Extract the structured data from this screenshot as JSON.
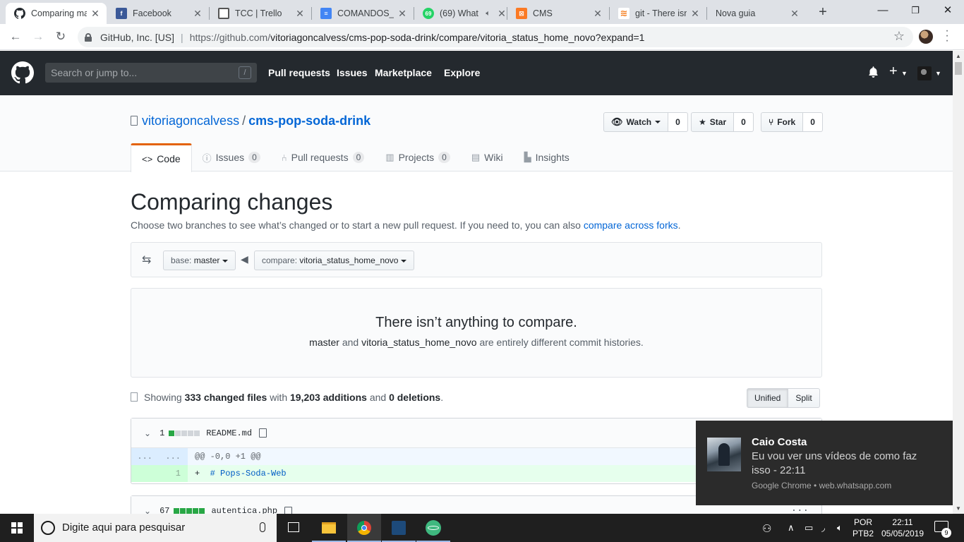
{
  "browser": {
    "tabs": [
      {
        "title": "Comparing ma",
        "favicon": "github-icon",
        "active": true
      },
      {
        "title": "Facebook",
        "favicon": "facebook-icon"
      },
      {
        "title": "TCC | Trello",
        "favicon": "trello-icon"
      },
      {
        "title": "COMANDOS_C",
        "favicon": "google-docs-icon"
      },
      {
        "title": "(69) What",
        "favicon": "whatsapp-icon",
        "badge": "69"
      },
      {
        "title": "CMS",
        "favicon": "xampp-icon"
      },
      {
        "title": "git - There isn",
        "favicon": "stackoverflow-icon"
      },
      {
        "title": "Nova guia",
        "favicon": ""
      }
    ],
    "address": {
      "org": "GitHub, Inc. [US]",
      "url_host": "https://github.com/",
      "url_path": "vitoriagoncalvess/cms-pop-soda-drink/compare/vitoria_status_home_novo?expand=1"
    }
  },
  "gh_header": {
    "search_placeholder": "Search or jump to...",
    "search_key": "/",
    "nav": [
      "Pull requests",
      "Issues",
      "Marketplace",
      "Explore"
    ]
  },
  "repo": {
    "owner": "vitoriagoncalvess",
    "separator": "/",
    "name": "cms-pop-soda-drink",
    "watch": {
      "label": "Watch",
      "count": "0"
    },
    "star": {
      "label": "Star",
      "count": "0"
    },
    "fork": {
      "label": "Fork",
      "count": "0"
    },
    "tabs": [
      {
        "label": "Code",
        "icon": "code-icon",
        "selected": true
      },
      {
        "label": "Issues",
        "icon": "issue-icon",
        "count": "0"
      },
      {
        "label": "Pull requests",
        "icon": "pull-request-icon",
        "count": "0"
      },
      {
        "label": "Projects",
        "icon": "project-icon",
        "count": "0"
      },
      {
        "label": "Wiki",
        "icon": "wiki-icon"
      },
      {
        "label": "Insights",
        "icon": "graph-icon"
      }
    ]
  },
  "compare": {
    "title": "Comparing changes",
    "subtitle": "Choose two branches to see what’s changed or to start a new pull request. If you need to, you can also",
    "subtitle_link": "compare across forks",
    "subtitle_end": ".",
    "base_prefix": "base:",
    "base_branch": "master",
    "compare_prefix": "compare:",
    "compare_branch": "vitoria_status_home_novo",
    "blank_title": "There isn’t anything to compare.",
    "blank_base": "master",
    "blank_and": "and",
    "blank_head": "vitoria_status_home_novo",
    "blank_rest": "are entirely different commit histories."
  },
  "toc": {
    "showing": "Showing",
    "changed_files": "333 changed files",
    "with": "with",
    "additions": "19,203 additions",
    "and": "and",
    "deletions": "0 deletions",
    "end": ".",
    "unified_label": "Unified",
    "split_label": "Split"
  },
  "files": [
    {
      "count": "1",
      "filename": "README.md",
      "diffstat": [
        1,
        0,
        0,
        0,
        0
      ],
      "hunk_left": "...",
      "hunk_right": "...",
      "hunk_header": "@@ -0,0 +1 @@",
      "line_no": "1",
      "line_sign": "+",
      "line_code": "# Pops-Soda-Web"
    },
    {
      "count": "67",
      "filename": "autentica.php",
      "diffstat": [
        1,
        1,
        1,
        1,
        1
      ]
    }
  ],
  "notification": {
    "sender": "Caio Costa",
    "message": "Eu vou ver uns vídeos de como faz isso - 22:11",
    "source": "Google Chrome • web.whatsapp.com"
  },
  "taskbar": {
    "search_placeholder": "Digite aqui para pesquisar",
    "lang_top": "POR",
    "lang_bottom": "PTB2",
    "time": "22:11",
    "date": "05/05/2019",
    "notification_count": "9"
  }
}
